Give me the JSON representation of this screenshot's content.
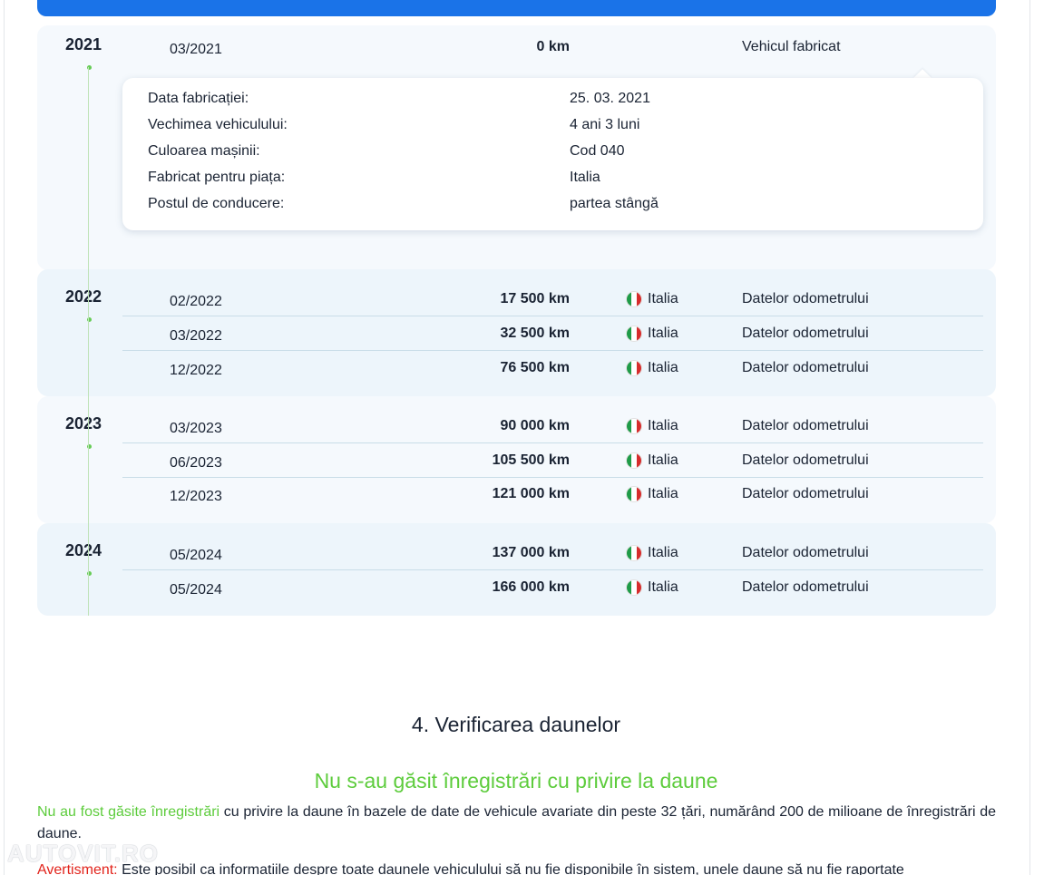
{
  "timeline": {
    "years": [
      {
        "year": "2021",
        "records": [
          {
            "date": "03/2021",
            "km": "0 km",
            "country": "",
            "event": "Vehicul fabricat"
          }
        ]
      },
      {
        "year": "2022",
        "records": [
          {
            "date": "02/2022",
            "km": "17 500 km",
            "country": "Italia",
            "event": "Datelor odometrului"
          },
          {
            "date": "03/2022",
            "km": "32 500 km",
            "country": "Italia",
            "event": "Datelor odometrului"
          },
          {
            "date": "12/2022",
            "km": "76 500 km",
            "country": "Italia",
            "event": "Datelor odometrului"
          }
        ]
      },
      {
        "year": "2023",
        "records": [
          {
            "date": "03/2023",
            "km": "90 000 km",
            "country": "Italia",
            "event": "Datelor odometrului"
          },
          {
            "date": "06/2023",
            "km": "105 500 km",
            "country": "Italia",
            "event": "Datelor odometrului"
          },
          {
            "date": "12/2023",
            "km": "121 000 km",
            "country": "Italia",
            "event": "Datelor odometrului"
          }
        ]
      },
      {
        "year": "2024",
        "records": [
          {
            "date": "05/2024",
            "km": "137 000 km",
            "country": "Italia",
            "event": "Datelor odometrului"
          },
          {
            "date": "05/2024",
            "km": "166 000 km",
            "country": "Italia",
            "event": "Datelor odometrului"
          }
        ]
      }
    ]
  },
  "details": [
    {
      "label": "Data fabricației:",
      "value": "25. 03. 2021"
    },
    {
      "label": "Vechimea vehiculului:",
      "value": "4 ani 3 luni"
    },
    {
      "label": "Culoarea mașinii:",
      "value": "Cod 040"
    },
    {
      "label": "Fabricat pentru piața:",
      "value": "Italia"
    },
    {
      "label": "Postul de conducere:",
      "value": "partea stângă"
    }
  ],
  "damage_section": {
    "title": "4. Verificarea daunelor",
    "result_title": "Nu s-au găsit înregistrări cu privire la daune",
    "paragraph1_highlight": "Nu au fost găsite înregistrări",
    "paragraph1_rest": " cu privire la daune în bazele de date de vehicule avariate din peste 32 țări, numărând 200 de milioane de înregistrări de daune.",
    "warning_label": "Avertisment:",
    "warning_text": " Este posibil ca informațiile despre toate daunele vehiculului să nu fie disponibile în sistem, unele daune să nu fie raportate"
  },
  "watermark": "AUTOVIT.RO",
  "colors": {
    "accent_blue": "#1a73e8",
    "green": "#5dcc3c",
    "red": "#e2241c",
    "panel_alt": "#edf5fb",
    "panel_plain": "#f5f9fd"
  }
}
